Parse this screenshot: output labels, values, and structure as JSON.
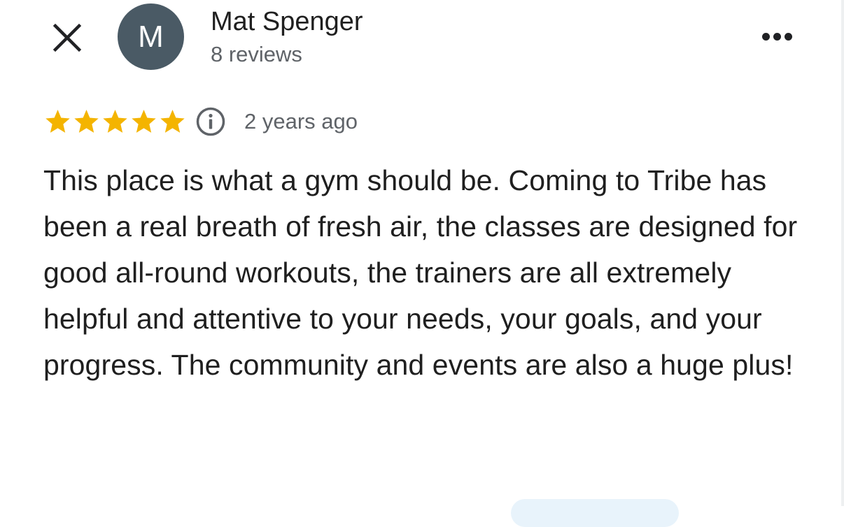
{
  "icons": {
    "close": "close-icon",
    "more": "more-vert-icon",
    "star": "star-icon",
    "info": "info-icon"
  },
  "colors": {
    "avatar_background": "#4a5a65",
    "star": "#f4b400",
    "secondary_text": "#5f6368"
  },
  "author": {
    "initial": "M",
    "name": "Mat Spenger",
    "reviews": "8 reviews"
  },
  "review": {
    "rating": 5,
    "max_rating": 5,
    "time_ago": "2 years ago",
    "text": "This place is what a gym should be. Coming to Tribe has been a real breath of fresh air, the classes are designed for good all-round workouts, the trainers are all extremely helpful and attentive to your needs, your goals, and your progress. The community and events are also a huge plus!"
  }
}
